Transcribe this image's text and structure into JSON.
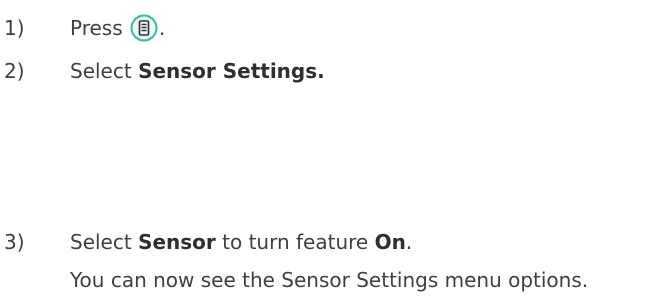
{
  "steps": [
    {
      "num": "1)",
      "text_before": "Press",
      "icon": "menu-button-icon",
      "text_after": "."
    },
    {
      "num": "2)",
      "text_before": "Select",
      "bold": "Sensor Settings."
    },
    {
      "num": "3)",
      "text_before": "Select",
      "bold": "Sensor",
      "text_middle": "to turn feature",
      "bold2": "On",
      "text_after": ".",
      "subtext": "You can now see the Sensor Settings menu options."
    }
  ],
  "colors": {
    "text": "#3f3f3f",
    "icon_accent": "#2fb8a8"
  }
}
